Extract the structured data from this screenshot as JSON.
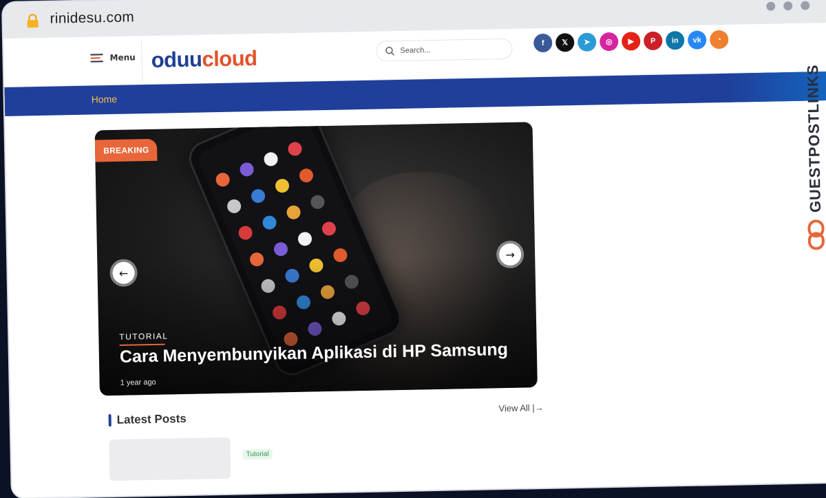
{
  "browser": {
    "url": "rinidesu.com"
  },
  "header": {
    "menu_label": "Menu",
    "logo_part1": "oduu",
    "logo_part2": "cloud",
    "search_placeholder": "Search...",
    "social": [
      {
        "name": "facebook-icon",
        "glyph": "f",
        "color": "#3b5998"
      },
      {
        "name": "x-icon",
        "glyph": "𝕏",
        "color": "#111111"
      },
      {
        "name": "telegram-icon",
        "glyph": "➤",
        "color": "#2a9bd6"
      },
      {
        "name": "instagram-icon",
        "glyph": "◎",
        "color": "#d6249f"
      },
      {
        "name": "youtube-icon",
        "glyph": "▶",
        "color": "#e62117"
      },
      {
        "name": "pinterest-icon",
        "glyph": "P",
        "color": "#cb2027"
      },
      {
        "name": "linkedin-icon",
        "glyph": "in",
        "color": "#0e76a8"
      },
      {
        "name": "vk-icon",
        "glyph": "vk",
        "color": "#2787f5"
      },
      {
        "name": "rss-icon",
        "glyph": "◔",
        "color": "#ee802f"
      }
    ]
  },
  "nav": {
    "items": [
      "Home"
    ]
  },
  "hero": {
    "badge": "BREAKING",
    "category": "TUTORIAL",
    "title": "Cara Menyembunyikan Aplikasi di HP Samsung",
    "time": "1 year ago"
  },
  "latest": {
    "title": "Latest Posts",
    "view_all": "View All |→",
    "first_tag": "Tutorial"
  },
  "watermark": {
    "text": "GUESTPOSTLINKS"
  },
  "colors": {
    "brand_blue": "#1f3f9a",
    "accent_orange": "#e8663a",
    "nav_home": "#f6c04a"
  }
}
